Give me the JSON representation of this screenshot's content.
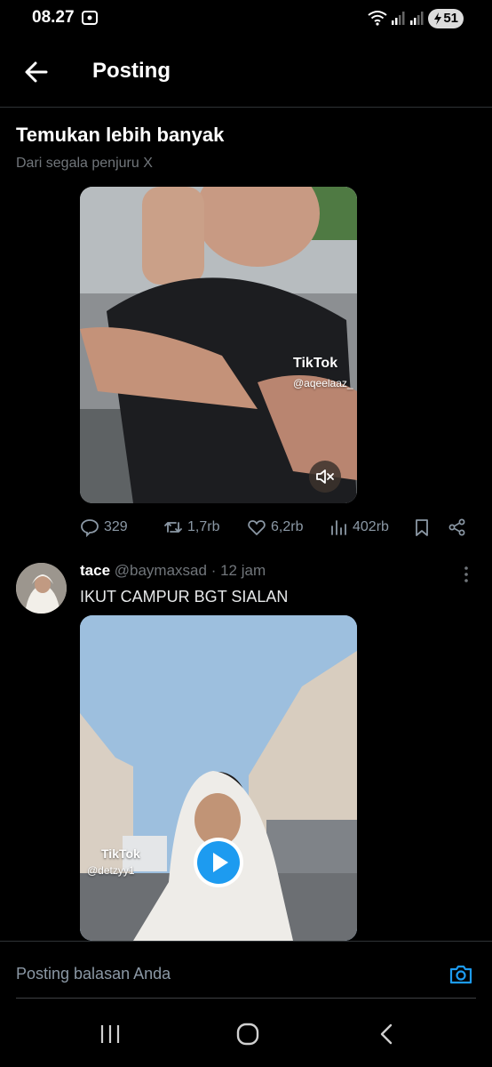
{
  "status_bar": {
    "time": "08.27",
    "battery": "51",
    "icons": [
      "screenshot-icon",
      "wifi-icon",
      "signal-icon",
      "signal-icon",
      "battery-icon"
    ]
  },
  "header": {
    "title": "Posting",
    "back_icon": "arrow-left-icon"
  },
  "discover": {
    "title": "Temukan lebih banyak",
    "subtitle": "Dari segala penjuru X"
  },
  "post1": {
    "video": {
      "watermark": "TikTok",
      "handle": "@aqeelaaz_",
      "mute_icon": "speaker-mute-icon"
    },
    "actions": {
      "replies": "329",
      "reposts": "1,7rb",
      "likes": "6,2rb",
      "views": "402rb"
    }
  },
  "post2": {
    "author": {
      "name": "tace",
      "handle": "@baymaxsad",
      "time": "· 12 jam"
    },
    "text": "IKUT CAMPUR BGT SIALAN",
    "video": {
      "watermark": "TikTok",
      "handle": "@detzyy1",
      "play_icon": "play-icon"
    }
  },
  "reply_bar": {
    "placeholder": "Posting balasan Anda",
    "camera_icon": "camera-icon"
  },
  "nav_bar": {
    "icons": [
      "recents-icon",
      "home-icon",
      "back-icon"
    ]
  },
  "colors": {
    "background": "#000000",
    "text": "#e7e9ea",
    "muted": "#71767b",
    "accent": "#1d9bf0",
    "divider": "#2f3336"
  }
}
